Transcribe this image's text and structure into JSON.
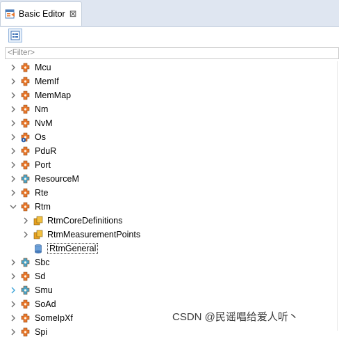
{
  "tab": {
    "title": "Basic Editor",
    "close_glyph": "⊠"
  },
  "filter": {
    "placeholder": "<Filter>"
  },
  "tree": [
    {
      "label": "Mcu",
      "icon": "orange-module-icon",
      "expanded": false,
      "level": 0
    },
    {
      "label": "MemIf",
      "icon": "orange-module-icon",
      "expanded": false,
      "level": 0
    },
    {
      "label": "MemMap",
      "icon": "orange-module-icon",
      "expanded": false,
      "level": 0
    },
    {
      "label": "Nm",
      "icon": "orange-module-icon",
      "expanded": false,
      "level": 0
    },
    {
      "label": "NvM",
      "icon": "orange-module-icon",
      "expanded": false,
      "level": 0
    },
    {
      "label": "Os",
      "icon": "locked-module-icon",
      "expanded": false,
      "level": 0
    },
    {
      "label": "PduR",
      "icon": "orange-module-icon",
      "expanded": false,
      "level": 0
    },
    {
      "label": "Port",
      "icon": "orange-module-icon",
      "expanded": false,
      "level": 0
    },
    {
      "label": "ResourceM",
      "icon": "blue-module-icon",
      "expanded": false,
      "level": 0
    },
    {
      "label": "Rte",
      "icon": "orange-module-icon",
      "expanded": false,
      "level": 0
    },
    {
      "label": "Rtm",
      "icon": "orange-module-icon",
      "expanded": true,
      "level": 0
    },
    {
      "label": "RtmCoreDefinitions",
      "icon": "container-icon",
      "expanded": false,
      "level": 1
    },
    {
      "label": "RtmMeasurementPoints",
      "icon": "container-icon",
      "expanded": false,
      "level": 1
    },
    {
      "label": "RtmGeneral",
      "icon": "parameter-container-icon",
      "expanded": null,
      "level": 1,
      "selected": true
    },
    {
      "label": "Sbc",
      "icon": "blue-module-icon",
      "expanded": false,
      "level": 0
    },
    {
      "label": "Sd",
      "icon": "orange-module-icon",
      "expanded": false,
      "level": 0
    },
    {
      "label": "Smu",
      "icon": "blue-module-icon",
      "expanded": false,
      "level": 0
    },
    {
      "label": "SoAd",
      "icon": "orange-module-icon",
      "expanded": false,
      "level": 0
    },
    {
      "label": "SomeIpXf",
      "icon": "orange-module-icon",
      "expanded": false,
      "level": 0
    },
    {
      "label": "Spi",
      "icon": "orange-module-icon",
      "expanded": false,
      "level": 0
    }
  ],
  "watermark": "CSDN @民谣唱给爱人听丶",
  "colors": {
    "orange": "#e8762b",
    "blue": "#4aa3c8",
    "tab_bg": "#dfe6f1"
  }
}
